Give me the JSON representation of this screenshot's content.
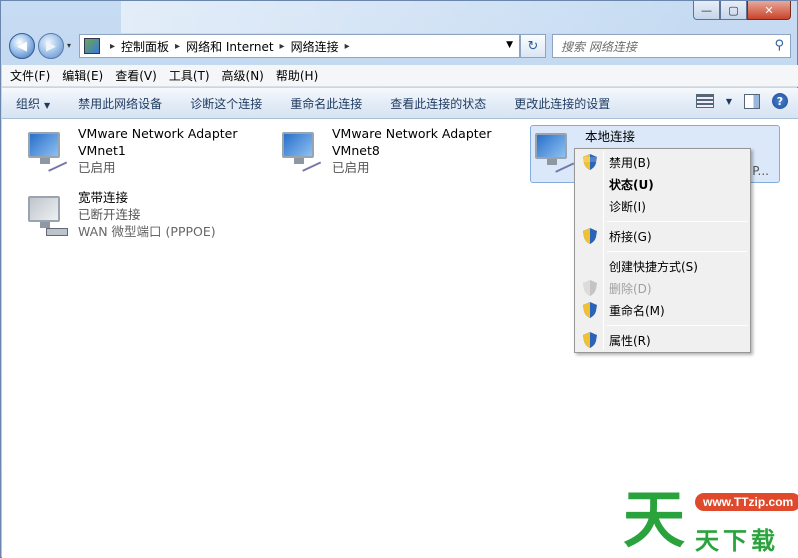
{
  "window": {
    "caption_buttons": [
      "—",
      "▢",
      "✕"
    ]
  },
  "nav": {
    "back_glyph": "◀",
    "forward_glyph": "▶",
    "dropdown_glyph": "▾",
    "breadcrumb": [
      "控制面板",
      "网络和 Internet",
      "网络连接"
    ],
    "refresh_glyph": "↻",
    "search_placeholder": "搜索 网络连接"
  },
  "menubar": [
    "文件(F)",
    "编辑(E)",
    "查看(V)",
    "工具(T)",
    "高级(N)",
    "帮助(H)"
  ],
  "commandbar": {
    "organize": "组织",
    "commands": [
      "禁用此网络设备",
      "诊断这个连接",
      "重命名此连接",
      "查看此连接的状态",
      "更改此连接的设置"
    ]
  },
  "connections": [
    {
      "name": "VMware Network Adapter",
      "line2": "VMnet1",
      "status": "已启用",
      "icon": "network-adapter-icon"
    },
    {
      "name": "VMware Network Adapter",
      "line2": "VMnet8",
      "status": "已启用",
      "icon": "network-adapter-icon"
    },
    {
      "name": "本地连接",
      "line2": "",
      "status": "",
      "trailing": "P...",
      "icon": "network-adapter-icon",
      "selected": true
    },
    {
      "name": "宽带连接",
      "line2": "已断开连接",
      "status": "WAN 微型端口 (PPPOE)",
      "icon": "broadband-modem-icon"
    }
  ],
  "context_menu": [
    {
      "label": "禁用(B)",
      "shield": true
    },
    {
      "label": "状态(U)",
      "bold": true
    },
    {
      "label": "诊断(I)"
    },
    {
      "separator": true
    },
    {
      "label": "桥接(G)",
      "shield": true
    },
    {
      "separator": true
    },
    {
      "label": "创建快捷方式(S)"
    },
    {
      "label": "删除(D)",
      "shield": true,
      "disabled": true
    },
    {
      "label": "重命名(M)",
      "shield": true
    },
    {
      "separator": true
    },
    {
      "label": "属性(R)",
      "shield": true
    }
  ],
  "watermark": {
    "url": "www.TTzip.com",
    "big_char": "天",
    "small_text": "天下载"
  },
  "colors": {
    "accent": "#3c78d8",
    "selection": "#dbe8f9",
    "watermark_green": "#2aa33c",
    "watermark_red": "#e04a2c"
  }
}
